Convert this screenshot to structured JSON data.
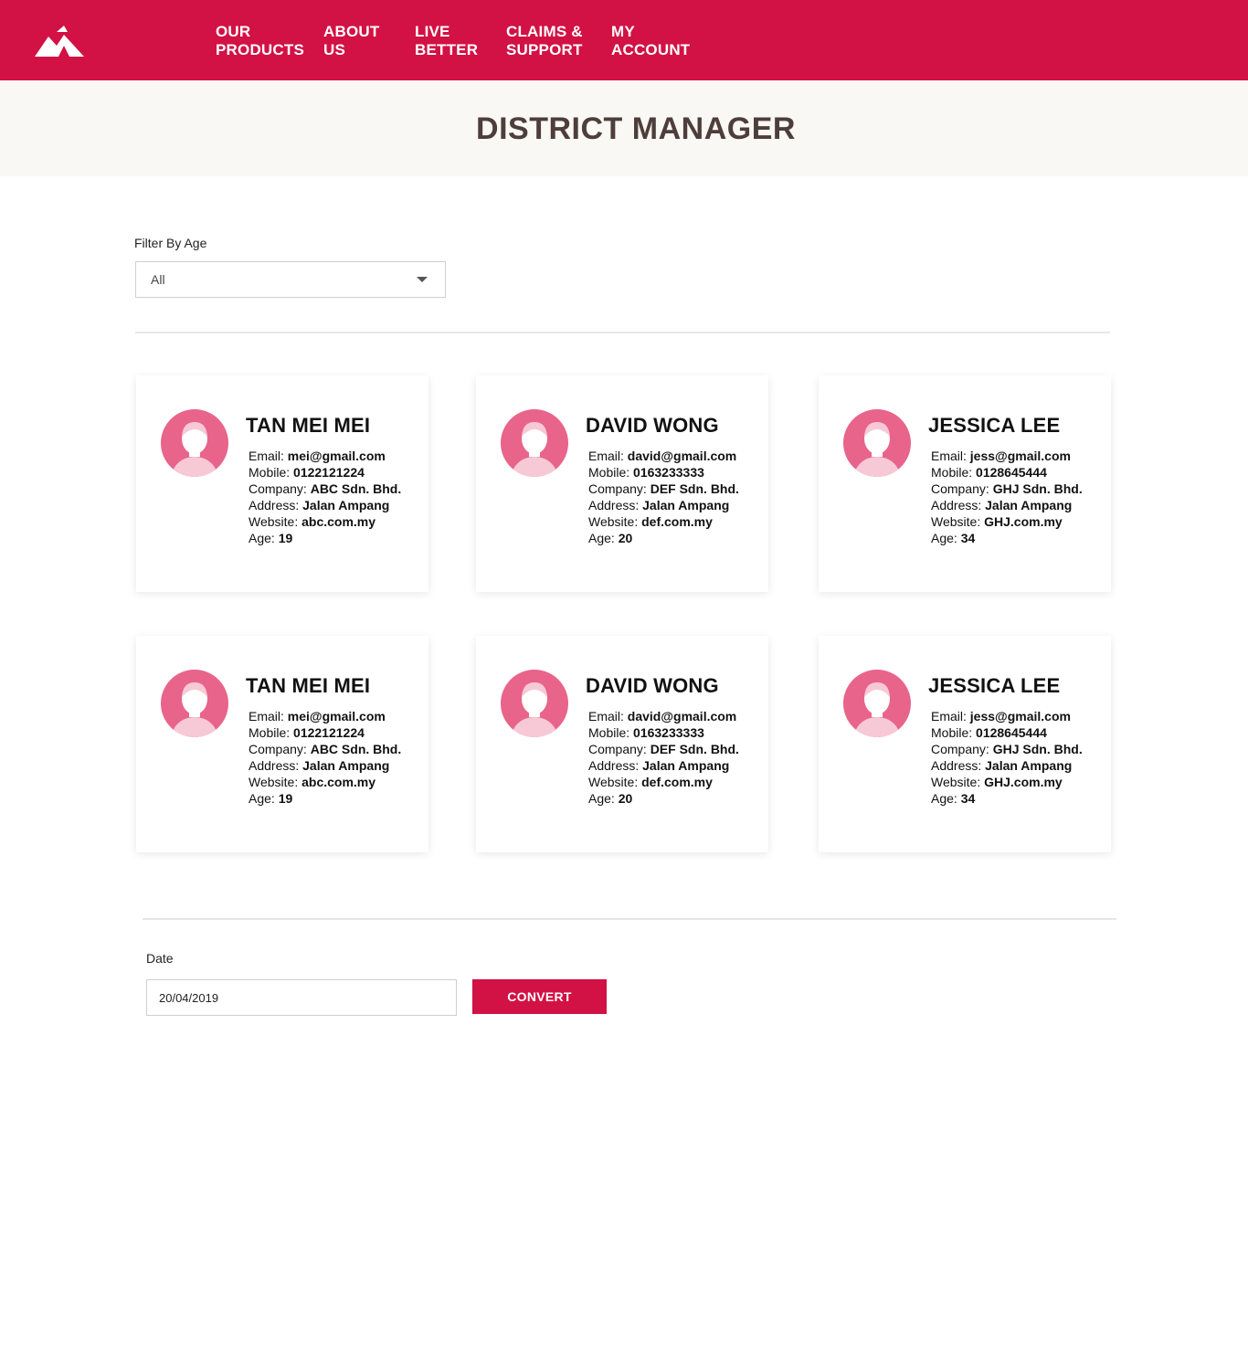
{
  "colors": {
    "brand": "#d21144",
    "title": "#4e3e3b",
    "band": "#f9f8f4",
    "avatar": "#e8648a",
    "avatar_light": "#f7c9d6"
  },
  "header": {
    "logo_icon": "mountain-logo-icon",
    "nav": [
      {
        "label": "OUR\nPRODUCTS"
      },
      {
        "label": "ABOUT\nUS"
      },
      {
        "label": "LIVE\nBETTER"
      },
      {
        "label": "CLAIMS &\nSUPPORT"
      },
      {
        "label": "MY\nACCOUNT"
      }
    ]
  },
  "page": {
    "title": "DISTRICT MANAGER"
  },
  "filter": {
    "label": "Filter By Age",
    "selected": "All"
  },
  "cards": [
    {
      "name": "TAN MEI MEI",
      "email_label": "Email:",
      "email": "mei@gmail.com",
      "mobile_label": "Mobile:",
      "mobile": "0122121224",
      "company_label": "Company:",
      "company": "ABC Sdn. Bhd.",
      "address_label": "Address:",
      "address": "Jalan Ampang",
      "website_label": "Website:",
      "website": "abc.com.my",
      "age_label": "Age:",
      "age": "19"
    },
    {
      "name": "DAVID WONG",
      "email_label": "Email:",
      "email": "david@gmail.com",
      "mobile_label": "Mobile:",
      "mobile": "0163233333",
      "company_label": "Company:",
      "company": "DEF Sdn. Bhd.",
      "address_label": "Address:",
      "address": "Jalan Ampang",
      "website_label": "Website:",
      "website": "def.com.my",
      "age_label": "Age:",
      "age": "20"
    },
    {
      "name": "JESSICA LEE",
      "email_label": "Email:",
      "email": "jess@gmail.com",
      "mobile_label": "Mobile:",
      "mobile": "0128645444",
      "company_label": "Company:",
      "company": "GHJ Sdn. Bhd.",
      "address_label": "Address:",
      "address": "Jalan Ampang",
      "website_label": "Website:",
      "website": "GHJ.com.my",
      "age_label": "Age:",
      "age": "34"
    },
    {
      "name": "TAN MEI MEI",
      "email_label": "Email:",
      "email": "mei@gmail.com",
      "mobile_label": "Mobile:",
      "mobile": "0122121224",
      "company_label": "Company:",
      "company": "ABC Sdn. Bhd.",
      "address_label": "Address:",
      "address": "Jalan Ampang",
      "website_label": "Website:",
      "website": "abc.com.my",
      "age_label": "Age:",
      "age": "19"
    },
    {
      "name": "DAVID WONG",
      "email_label": "Email:",
      "email": "david@gmail.com",
      "mobile_label": "Mobile:",
      "mobile": "0163233333",
      "company_label": "Company:",
      "company": "DEF Sdn. Bhd.",
      "address_label": "Address:",
      "address": "Jalan Ampang",
      "website_label": "Website:",
      "website": "def.com.my",
      "age_label": "Age:",
      "age": "20"
    },
    {
      "name": "JESSICA LEE",
      "email_label": "Email:",
      "email": "jess@gmail.com",
      "mobile_label": "Mobile:",
      "mobile": "0128645444",
      "company_label": "Company:",
      "company": "GHJ Sdn. Bhd.",
      "address_label": "Address:",
      "address": "Jalan Ampang",
      "website_label": "Website:",
      "website": "GHJ.com.my",
      "age_label": "Age:",
      "age": "34"
    }
  ],
  "date_form": {
    "label": "Date",
    "value": "20/04/2019",
    "button_label": "CONVERT"
  }
}
